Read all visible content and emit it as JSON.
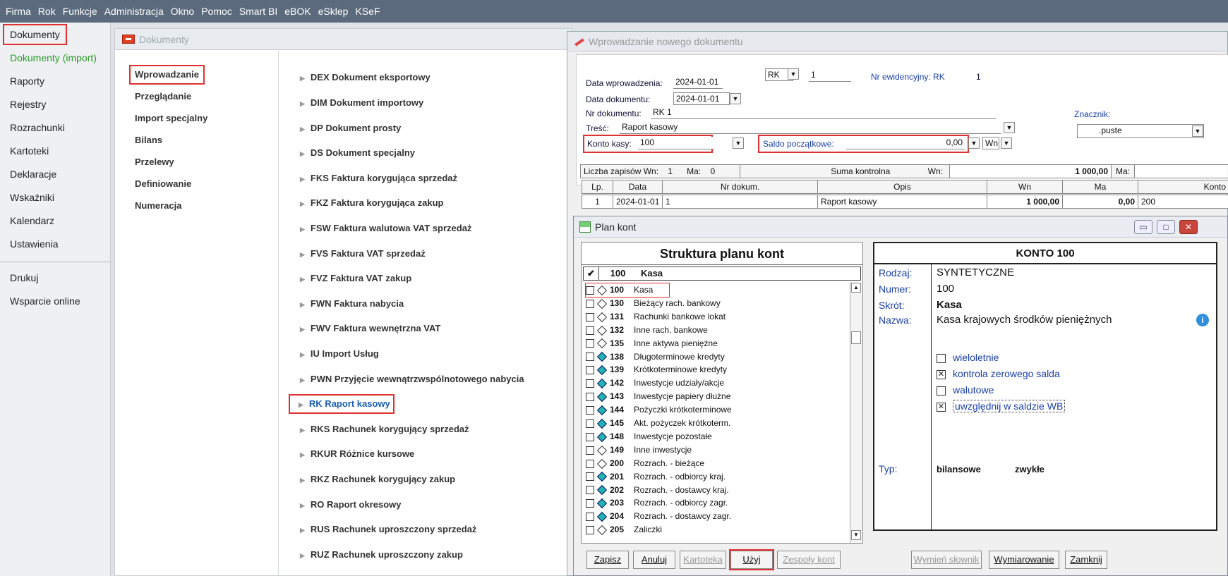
{
  "menubar": [
    "Firma",
    "Rok",
    "Funkcje",
    "Administracja",
    "Okno",
    "Pomoc",
    "Smart BI",
    "eBOK",
    "eSklep",
    "KSeF"
  ],
  "leftnav": {
    "items": [
      "Dokumenty",
      "Dokumenty (import)",
      "Raporty",
      "Rejestry",
      "Rozrachunki",
      "Kartoteki",
      "Deklaracje",
      "Wskaźniki",
      "Kalendarz",
      "Ustawienia"
    ],
    "items2": [
      "Drukuj",
      "Wsparcie online"
    ]
  },
  "dok": {
    "title": "Dokumenty",
    "sub": [
      "Wprowadzanie",
      "Przeglądanie",
      "Import specjalny",
      "Bilans",
      "Przelewy",
      "Definiowanie",
      "Numeracja"
    ],
    "docs": [
      "DEX Dokument eksportowy",
      "DIM Dokument importowy",
      "DP Dokument prosty",
      "DS Dokument specjalny",
      "FKS Faktura korygująca sprzedaż",
      "FKZ Faktura korygująca zakup",
      "FSW Faktura walutowa VAT sprzedaż",
      "FVS Faktura VAT sprzedaż",
      "FVZ Faktura VAT zakup",
      "FWN Faktura nabycia",
      "FWV Faktura wewnętrzna VAT",
      "IU Import Usług",
      "PWN Przyjęcie wewnątrzwspólnotowego nabycia",
      "RK Raport kasowy",
      "RKS Rachunek korygujący sprzedaż",
      "RKUR Różnice kursowe",
      "RKZ Rachunek korygujący zakup",
      "RO Raport okresowy",
      "RUS Rachunek uproszczony sprzedaż",
      "RUZ Rachunek uproszczony zakup"
    ]
  },
  "wpw": {
    "title": "Wprowadzanie nowego dokumentu",
    "data_wpr_label": "Data wprowadzenia:",
    "data_wpr": "2024-01-01",
    "data_dok_label": "Data dokumentu:",
    "data_dok": "2024-01-01",
    "nr_dok_label": "Nr dokumentu:",
    "nr_dok": "RK 1",
    "tresc_label": "Treść:",
    "tresc": "Raport kasowy",
    "konto_label": "Konto kasy:",
    "konto": "100",
    "saldo_label": "Saldo początkowe:",
    "saldo": "0,00",
    "saldo_side": "Wn",
    "rk_sel": "RK",
    "rk_num": "1",
    "nr_ew_label": "Nr ewidencyjny: RK",
    "nr_ew": "1",
    "znacznik_label": "Znacznik:",
    "znacznik": ".puste",
    "liczba_label": "Liczba zapisów Wn:",
    "liczba_wn": "1",
    "ma_label": "Ma:",
    "liczba_ma": "0",
    "suma_label": "Suma kontrolna",
    "suma_wn_label": "Wn:",
    "suma_wn": "1 000,00",
    "suma_ma_label": "Ma:",
    "cols": [
      "Lp.",
      "Data",
      "Nr dokum.",
      "Opis",
      "Wn",
      "Ma",
      "Konto"
    ],
    "row": [
      "1",
      "2024-01-01",
      "1",
      "Raport kasowy",
      "1 000,00",
      "0,00",
      "200"
    ]
  },
  "plan": {
    "title": "Plan kont",
    "tree_title": "Struktura planu kont",
    "selected_num": "100",
    "selected_name": "Kasa",
    "accounts": [
      {
        "num": "100",
        "name": "Kasa",
        "teal": false
      },
      {
        "num": "130",
        "name": "Bieżący rach. bankowy",
        "teal": false
      },
      {
        "num": "131",
        "name": "Rachunki bankowe lokat",
        "teal": false
      },
      {
        "num": "132",
        "name": "Inne rach. bankowe",
        "teal": false
      },
      {
        "num": "135",
        "name": "Inne aktywa pieniężne",
        "teal": false
      },
      {
        "num": "138",
        "name": "Długoterminowe kredyty",
        "teal": true
      },
      {
        "num": "139",
        "name": "Krótkoterminowe kredyty",
        "teal": true
      },
      {
        "num": "142",
        "name": "Inwestycje udziały/akcje",
        "teal": true
      },
      {
        "num": "143",
        "name": "Inwestycje papiery dłużne",
        "teal": true
      },
      {
        "num": "144",
        "name": "Pożyczki krótkoterminowe",
        "teal": true
      },
      {
        "num": "145",
        "name": "Akt. pożyczek krótkoterm.",
        "teal": true
      },
      {
        "num": "148",
        "name": "Inwestycje pozostałe",
        "teal": true
      },
      {
        "num": "149",
        "name": "Inne inwestycje",
        "teal": false
      },
      {
        "num": "200",
        "name": "Rozrach. - bieżące",
        "teal": false
      },
      {
        "num": "201",
        "name": "Rozrach. - odbiorcy kraj.",
        "teal": true
      },
      {
        "num": "202",
        "name": "Rozrach. - dostawcy kraj.",
        "teal": true
      },
      {
        "num": "203",
        "name": "Rozrach. - odbiorcy zagr.",
        "teal": true
      },
      {
        "num": "204",
        "name": "Rozrach. - dostawcy zagr.",
        "teal": true
      },
      {
        "num": "205",
        "name": "Zaliczki",
        "teal": false
      }
    ],
    "detail": {
      "title": "KONTO  100",
      "rodzaj_label": "Rodzaj:",
      "rodzaj": "SYNTETYCZNE",
      "numer_label": "Numer:",
      "numer": "100",
      "skrot_label": "Skrót:",
      "skrot": "Kasa",
      "nazwa_label": "Nazwa:",
      "nazwa": "Kasa krajowych środków pieniężnych",
      "checks": [
        {
          "label": "wieloletnie",
          "checked": false
        },
        {
          "label": "kontrola zerowego salda",
          "checked": true
        },
        {
          "label": "walutowe",
          "checked": false
        },
        {
          "label": "uwzględnij w saldzie WB",
          "checked": true
        }
      ],
      "typ_label": "Typ:",
      "typ1": "bilansowe",
      "typ2": "zwykłe"
    },
    "buttons": [
      "Zapisz",
      "Anuluj",
      "Kartoteka",
      "Użyj",
      "Zespoły kont",
      "Wymień słownik",
      "Wymiarowanie",
      "Zamknij"
    ]
  }
}
